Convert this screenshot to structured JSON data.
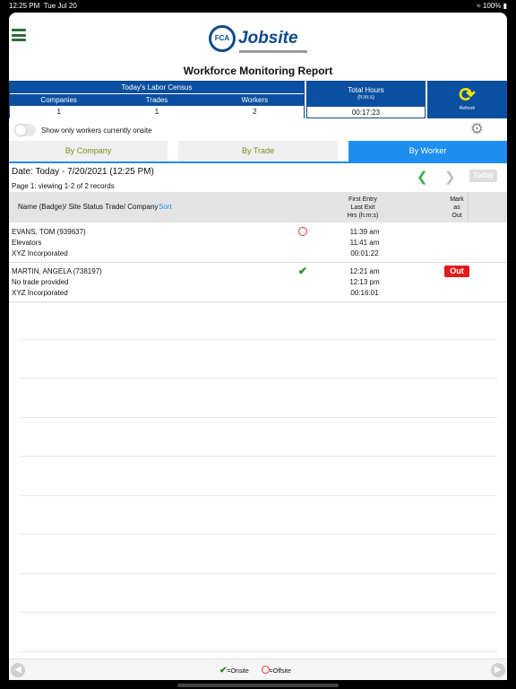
{
  "status_bar": {
    "time": "12:25 PM",
    "date": "Tue Jul 20",
    "battery": "100%"
  },
  "header": {
    "logo_text": "Jobsite",
    "logo_badge": "FCA",
    "title": "Workforce Monitoring Report"
  },
  "census": {
    "title": "Today's Labor Census",
    "columns": [
      "Companies",
      "Trades",
      "Workers"
    ],
    "values": [
      "1",
      "1",
      "2"
    ]
  },
  "total_hours": {
    "label": "Total Hours",
    "unit": "(h:m:s)",
    "value": "00:17:23"
  },
  "refresh": {
    "label": "Refresh"
  },
  "filter": {
    "toggle_label": "Show only workers currently onsite",
    "on": false
  },
  "tabs": [
    "By Company",
    "By Trade",
    "By Worker"
  ],
  "active_tab": "By Worker",
  "date_text": "Date: Today - 7/20/2021 (12:25 PM)",
  "page_info": "Page 1:  viewing 1-2 of 2 records",
  "today_button": "Today",
  "table": {
    "col_name": "Name (Badge)/ Site Status Trade/ Company",
    "sort_label": "Sort",
    "col_entry": [
      "First Entry",
      "Last Exit",
      "Hrs (h:m:s)"
    ],
    "col_mark": [
      "Mark",
      "as",
      "Out"
    ],
    "rows": [
      {
        "name": "EVANS, TOM (939637)",
        "trade": "Elevators",
        "company": "XYZ Incorporated",
        "status": "offsite",
        "first_entry": "11:39 am",
        "last_exit": "11:41 am",
        "hours": "00:01:22",
        "out_label": ""
      },
      {
        "name": "MARTIN, ANGELA (738197)",
        "trade": "No trade provided",
        "company": "XYZ Incorporated",
        "status": "onsite",
        "first_entry": "12:21 am",
        "last_exit": "12:13 pm",
        "hours": "00:16:01",
        "out_label": "Out"
      }
    ]
  },
  "legend": {
    "onsite": "=Onsite",
    "offsite": "=Offsite"
  },
  "colors": {
    "primary": "#0b4fa0",
    "tab_active": "#1e8ef0",
    "tab_text": "#7d8d1e",
    "out": "#e21a1a",
    "refresh_icon": "#f1e600"
  }
}
